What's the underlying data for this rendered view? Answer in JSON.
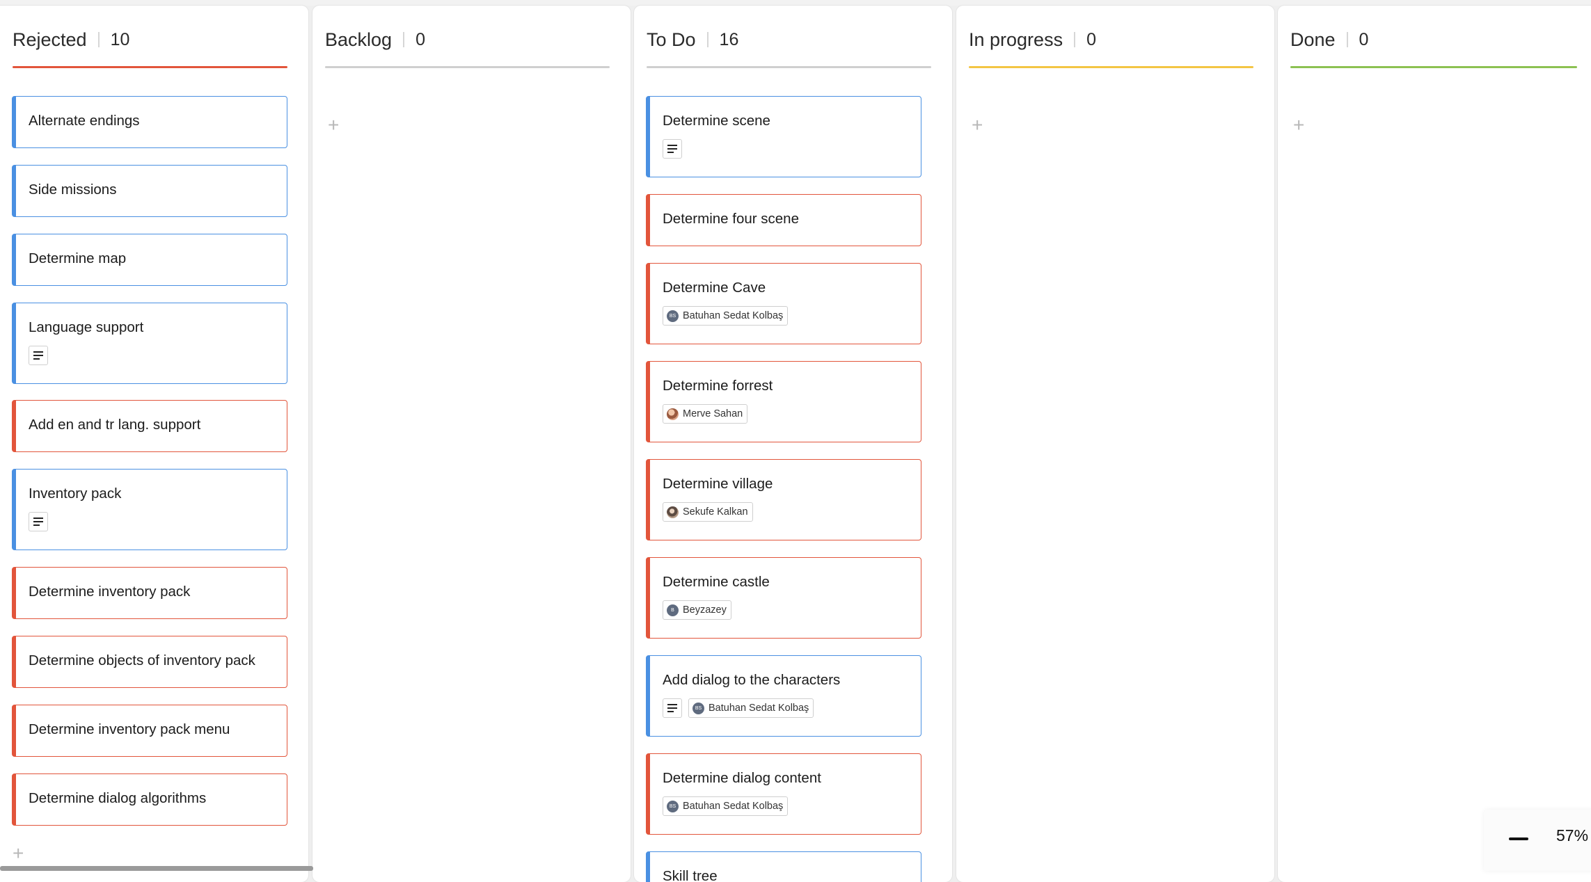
{
  "columns": [
    {
      "title": "Rejected",
      "count": "10",
      "line_color": "#e2553b",
      "cards": [
        {
          "title": "Alternate endings",
          "color": "blue"
        },
        {
          "title": "Side missions",
          "color": "blue"
        },
        {
          "title": "Determine map",
          "color": "blue"
        },
        {
          "title": "Language support",
          "color": "blue",
          "has_description": true
        },
        {
          "title": "Add en and tr lang. support",
          "color": "red"
        },
        {
          "title": "Inventory pack",
          "color": "blue",
          "has_description": true
        },
        {
          "title": "Determine inventory pack",
          "color": "red"
        },
        {
          "title": "Determine objects of inventory pack",
          "color": "red"
        },
        {
          "title": "Determine inventory pack menu",
          "color": "red"
        },
        {
          "title": "Determine dialog algorithms",
          "color": "red"
        }
      ]
    },
    {
      "title": "Backlog",
      "count": "0",
      "line_color": "#cfcfcf",
      "cards": []
    },
    {
      "title": "To Do",
      "count": "16",
      "line_color": "#cfcfcf",
      "cards": [
        {
          "title": "Determine scene",
          "color": "blue",
          "has_description": true
        },
        {
          "title": "Determine four scene",
          "color": "red"
        },
        {
          "title": "Determine Cave",
          "color": "red",
          "assignee": "Batuhan Sedat Kolbaş",
          "avatar": "BS"
        },
        {
          "title": "Determine  forrest",
          "color": "red",
          "assignee": "Merve Sahan",
          "avatar": "photo1"
        },
        {
          "title": "Determine village",
          "color": "red",
          "assignee": "Sekufe Kalkan",
          "avatar": "photo2"
        },
        {
          "title": "Determine castle",
          "color": "red",
          "assignee": "Beyzazey",
          "avatar": "B"
        },
        {
          "title": "Add dialog to the characters",
          "color": "blue",
          "has_description": true,
          "assignee": "Batuhan Sedat Kolbaş",
          "avatar": "BS"
        },
        {
          "title": "Determine dialog content",
          "color": "red",
          "assignee": "Batuhan Sedat Kolbaş",
          "avatar": "BS"
        },
        {
          "title": "Skill tree",
          "color": "blue"
        }
      ]
    },
    {
      "title": "In progress",
      "count": "0",
      "line_color": "#f3c544",
      "cards": []
    },
    {
      "title": "Done",
      "count": "0",
      "line_color": "#8cc152",
      "cards": []
    }
  ],
  "add_symbol": "+",
  "zoom": {
    "value": "57%"
  },
  "colors": {
    "blue": "#4a90e2",
    "red": "#e2553b"
  }
}
